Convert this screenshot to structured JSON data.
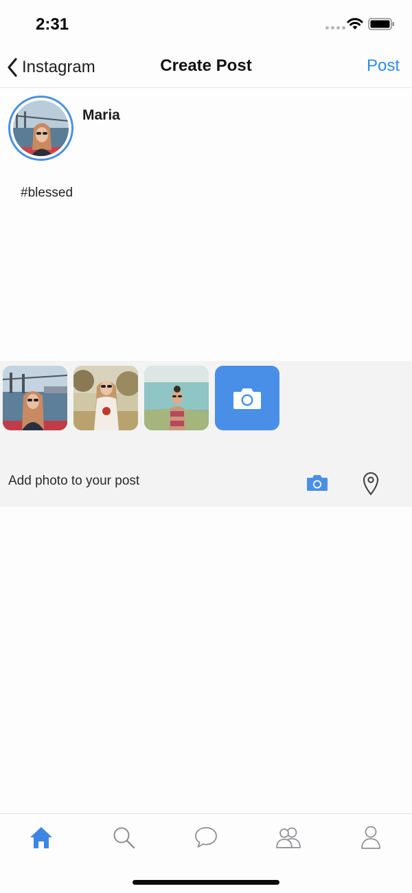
{
  "status_bar": {
    "time": "2:31"
  },
  "nav": {
    "back_label": "Instagram",
    "title": "Create Post",
    "post_label": "Post"
  },
  "author": {
    "name": "Maria"
  },
  "post": {
    "text": "#blessed"
  },
  "media_tray": {
    "thumbnails": [
      "photo-bridge-river",
      "photo-outdoor-park",
      "photo-beach-sea"
    ],
    "add_photo_label": "Add photo to your post"
  },
  "tab_bar": {
    "tabs": [
      "home-icon",
      "search-icon",
      "chat-bubble-icon",
      "friends-icon",
      "profile-icon"
    ],
    "active_index": 0
  },
  "colors": {
    "accent": "#2f8bf0",
    "camera_tile": "#4a8fe7",
    "tray_background": "#f3f3f4",
    "inactive_icon": "#8e8e93"
  }
}
